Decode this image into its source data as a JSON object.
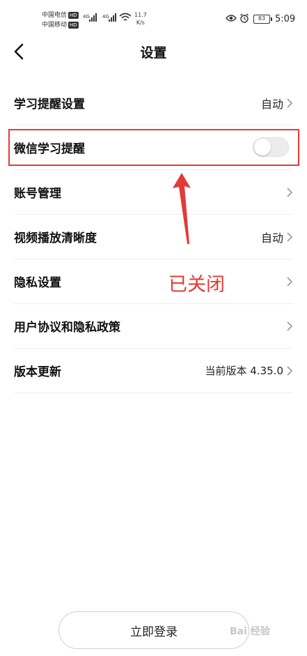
{
  "status_bar": {
    "carrier1": "中国电信",
    "carrier2": "中国移动",
    "hd": "HD",
    "network1": "4G",
    "network2": "4G",
    "speed_value": "11.7",
    "speed_unit": "K/s",
    "battery": "83",
    "time": "5:09"
  },
  "header": {
    "title": "设置"
  },
  "settings": {
    "study_reminder": {
      "label": "学习提醒设置",
      "value": "自动"
    },
    "wechat_reminder": {
      "label": "微信学习提醒",
      "enabled": false
    },
    "account": {
      "label": "账号管理"
    },
    "video_quality": {
      "label": "视频播放清晰度",
      "value": "自动"
    },
    "privacy": {
      "label": "隐私设置"
    },
    "agreement": {
      "label": "用户协议和隐私政策"
    },
    "version": {
      "label": "版本更新",
      "value": "当前版本 4.35.0"
    }
  },
  "annotation": {
    "note": "已关闭",
    "color": "#e53935"
  },
  "login": {
    "label": "立即登录"
  },
  "watermark": {
    "text": "Bai 经验"
  }
}
